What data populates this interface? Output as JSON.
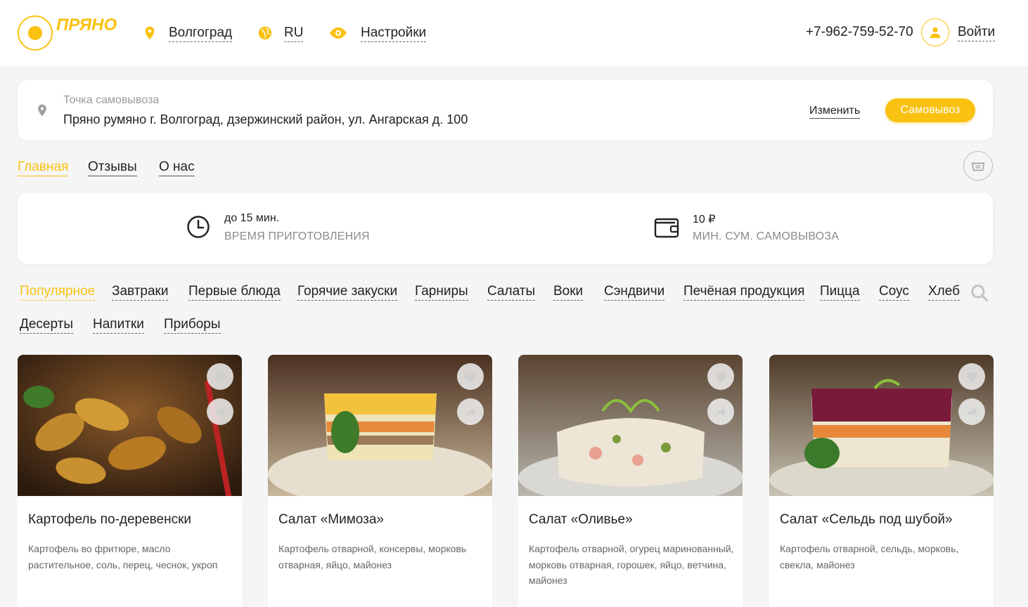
{
  "brand": {
    "logo_text": "ПРЯНО",
    "accent_color": "#f9c110"
  },
  "header": {
    "city": "Волгоград",
    "language": "RU",
    "settings": "Настройки",
    "phone": "+7-962-759-52-70",
    "login": "Войти",
    "icons": {
      "city": "map-pin-icon",
      "language": "globe-icon",
      "settings": "eye-icon",
      "login": "user-icon"
    }
  },
  "pickup": {
    "label": "Точка самовывоза",
    "address": "Пряно румяно г. Волгоград, дзержинский район, ул. Ангарская д. 100",
    "change": "Изменить",
    "mode_button": "Самовывоз"
  },
  "tabs": [
    {
      "label": "Главная",
      "active": true
    },
    {
      "label": "Отзывы",
      "active": false
    },
    {
      "label": "О нас",
      "active": false
    }
  ],
  "info": {
    "prep_time_value": "до 15 мин.",
    "prep_time_label": "ВРЕМЯ ПРИГОТОВЛЕНИЯ",
    "min_sum_value": "10 ₽",
    "min_sum_label": "МИН. СУМ. САМОВЫВОЗА"
  },
  "categories": [
    {
      "label": "Популярное",
      "active": true
    },
    {
      "label": "Завтраки"
    },
    {
      "label": "Первые блюда"
    },
    {
      "label": "Горячие закуски"
    },
    {
      "label": "Гарниры"
    },
    {
      "label": "Салаты"
    },
    {
      "label": "Воки"
    },
    {
      "label": "Сэндвичи"
    },
    {
      "label": "Печёная продукция"
    },
    {
      "label": "Пицца"
    },
    {
      "label": "Соус"
    },
    {
      "label": "Хлеб"
    },
    {
      "label": "Десерты"
    },
    {
      "label": "Напитки"
    },
    {
      "label": "Приборы"
    }
  ],
  "products": [
    {
      "title": "Картофель по-деревенски",
      "desc": "Картофель во фритюре, масло растительное, соль, перец, чеснок, укроп"
    },
    {
      "title": "Салат «Мимоза»",
      "desc": "Картофель отварной, консервы, морковь отварная, яйцо, майонез"
    },
    {
      "title": "Салат «Оливье»",
      "desc": "Картофель отварной, огурец маринованный, морковь отварная, горошек, яйцо, ветчина, майонез"
    },
    {
      "title": "Салат «Сельдь под шубой»",
      "desc": "Картофель отварной, сельдь, морковь, свекла, майонез"
    }
  ]
}
